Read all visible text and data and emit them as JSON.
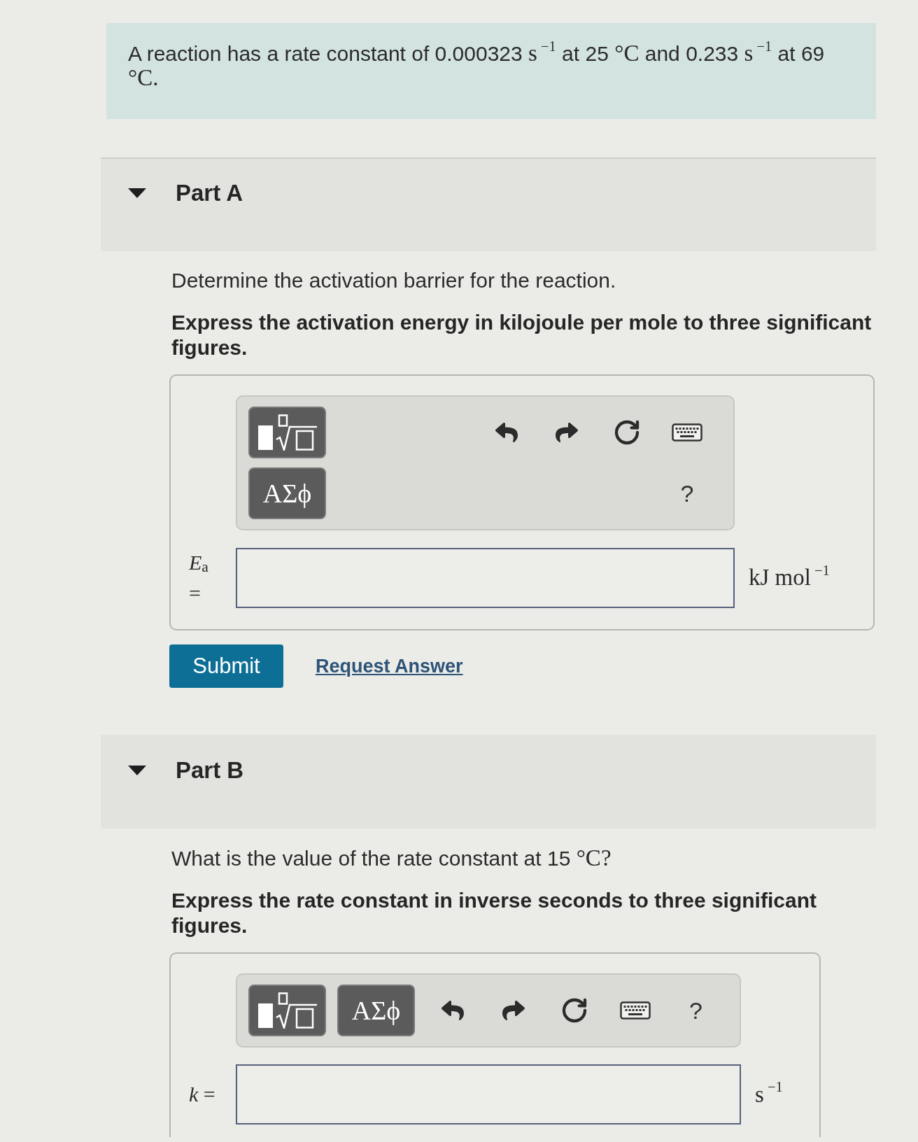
{
  "problem": {
    "segments": [
      {
        "kind": "text",
        "text": "A reaction has a rate constant of 0.000323 "
      },
      {
        "kind": "math",
        "text": "s$^{−1}$"
      },
      {
        "kind": "text",
        "text": " at 25 "
      },
      {
        "kind": "math",
        "text": "°C"
      },
      {
        "kind": "text",
        "text": " and 0.233 "
      },
      {
        "kind": "math",
        "text": "s$^{−1}$"
      },
      {
        "kind": "text",
        "text": " at 69 "
      },
      {
        "kind": "math",
        "text": "°C."
      }
    ]
  },
  "parts": [
    {
      "label": "Part A",
      "expanded": true,
      "question": [
        {
          "kind": "text",
          "text": "Determine the activation barrier for the reaction."
        }
      ],
      "instruction": "Express the activation energy in kilojoule per mole to three significant figures.",
      "answer": {
        "toolbar": {
          "kind": "two-row",
          "items": [
            {
              "kind": "templates"
            },
            {
              "kind": "symbols",
              "label": "ΑΣϕ"
            },
            {
              "kind": "undo"
            },
            {
              "kind": "redo"
            },
            {
              "kind": "reset"
            },
            {
              "kind": "keyboard"
            },
            {
              "kind": "help",
              "label": "?"
            }
          ]
        },
        "label": "*E*$_{a}$ =",
        "unit": "kJ mol$^{−1}$"
      },
      "actions": {
        "submit": "Submit",
        "request_answer": "Request Answer"
      }
    },
    {
      "label": "Part B",
      "expanded": true,
      "question": [
        {
          "kind": "text",
          "text": "What is the value of the rate constant at 15 "
        },
        {
          "kind": "math",
          "text": "°C?"
        }
      ],
      "instruction": "Express the rate constant in inverse seconds to three significant figures.",
      "answer": {
        "toolbar": {
          "kind": "one-row",
          "items": [
            {
              "kind": "templates"
            },
            {
              "kind": "symbols",
              "label": "ΑΣϕ"
            },
            {
              "kind": "undo"
            },
            {
              "kind": "redo"
            },
            {
              "kind": "reset"
            },
            {
              "kind": "keyboard"
            },
            {
              "kind": "help",
              "label": "?"
            }
          ]
        },
        "label": "*k* =",
        "unit": "s$^{−1}$"
      }
    }
  ]
}
